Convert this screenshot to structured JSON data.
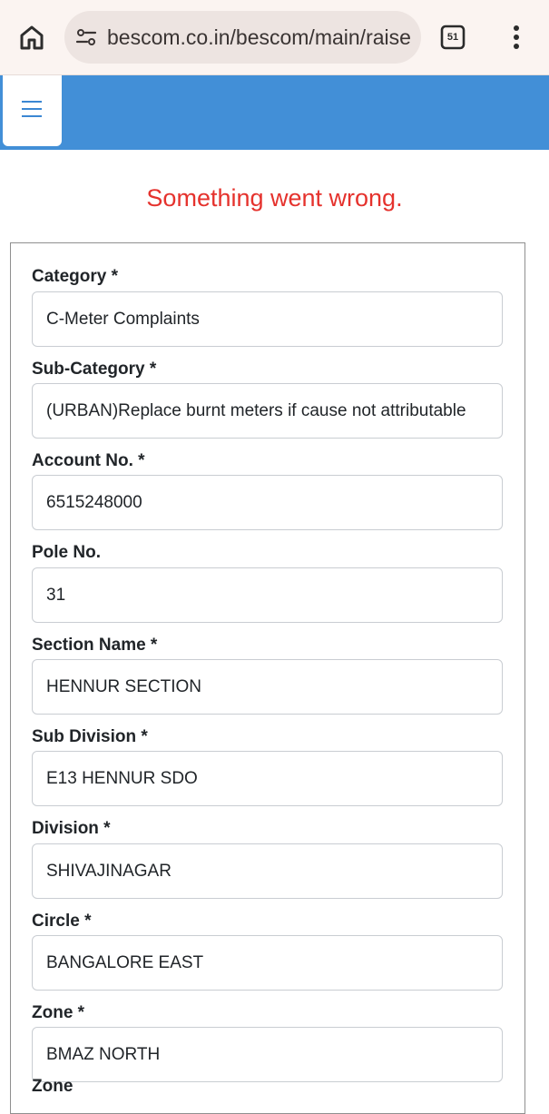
{
  "browser": {
    "url": "bescom.co.in/bescom/main/raise",
    "tab_count": "51"
  },
  "page": {
    "error_message": "Something went wrong."
  },
  "form": {
    "fields": [
      {
        "label": "Category *",
        "value": "C-Meter Complaints"
      },
      {
        "label": "Sub-Category *",
        "value": "(URBAN)Replace burnt meters if cause not attributable"
      },
      {
        "label": "Account No. *",
        "value": "6515248000"
      },
      {
        "label": "Pole No.",
        "value": "31"
      },
      {
        "label": "Section Name *",
        "value": "HENNUR SECTION"
      },
      {
        "label": "Sub Division *",
        "value": "E13 HENNUR SDO"
      },
      {
        "label": "Division *",
        "value": "SHIVAJINAGAR"
      },
      {
        "label": "Circle *",
        "value": "BANGALORE EAST"
      },
      {
        "label": "Zone *",
        "value": "BMAZ NORTH"
      },
      {
        "label": "Zone",
        "value": ""
      }
    ]
  },
  "colors": {
    "header_blue": "#428fd7",
    "error_red": "#e5322d"
  }
}
